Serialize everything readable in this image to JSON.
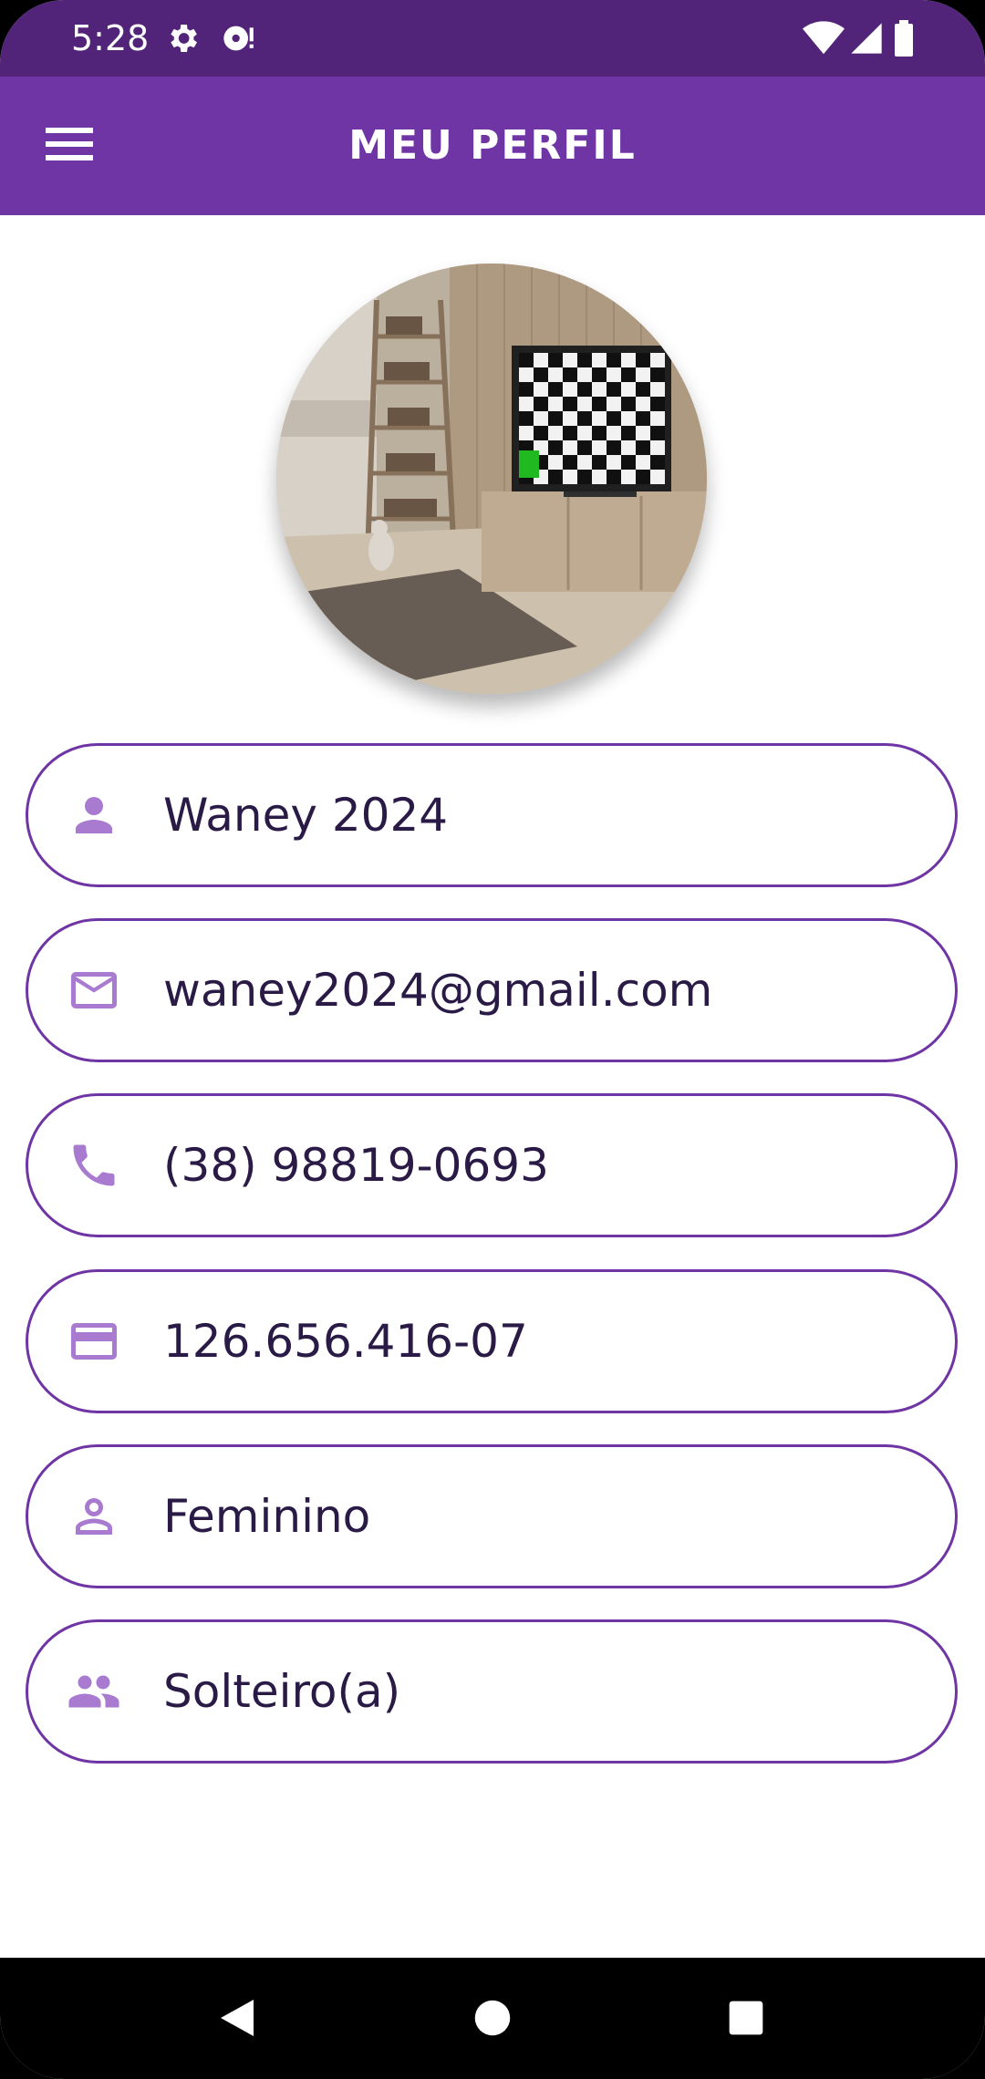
{
  "status_bar": {
    "time": "5:28",
    "icons": [
      "settings-icon",
      "sd-card-alert-icon",
      "wifi-icon",
      "signal-icon",
      "battery-icon"
    ]
  },
  "app_bar": {
    "title": "MEU PERFIL",
    "menu_icon": "menu-icon"
  },
  "profile": {
    "avatar_icon": "profile-photo",
    "fields": [
      {
        "icon": "person-icon",
        "value": "Waney 2024"
      },
      {
        "icon": "email-icon",
        "value": "waney2024@gmail.com"
      },
      {
        "icon": "phone-icon",
        "value": "(38) 98819-0693"
      },
      {
        "icon": "credit-card-icon",
        "value": "126.656.416-07"
      },
      {
        "icon": "person-outline-icon",
        "value": "Feminino"
      },
      {
        "icon": "people-icon",
        "value": "Solteiro(a)"
      }
    ]
  },
  "nav_bar": {
    "buttons": [
      "back-icon",
      "home-icon",
      "recents-icon"
    ]
  },
  "colors": {
    "status_bar": "#522479",
    "app_bar": "#6f35a5",
    "accent_icon": "#a87bd0",
    "field_border": "#6f35a5",
    "field_text": "#2a1a46"
  }
}
